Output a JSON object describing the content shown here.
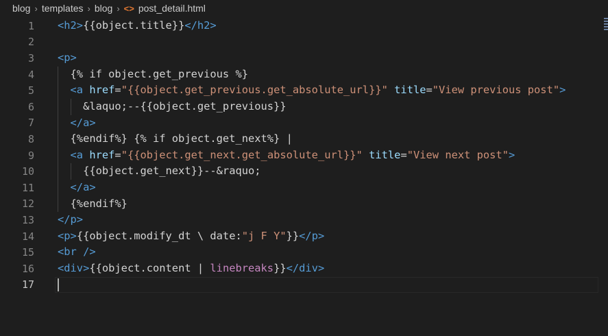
{
  "breadcrumb": {
    "items": [
      "blog",
      "templates",
      "blog"
    ],
    "file": "post_detail.html",
    "file_icon": "html-file-icon"
  },
  "editor": {
    "active_line": 17,
    "lines": [
      {
        "n": "1",
        "tokens": [
          [
            "tag",
            "<h2>"
          ],
          [
            "tpl",
            "{{object.title}}"
          ],
          [
            "tag",
            "</h2>"
          ]
        ]
      },
      {
        "n": "2",
        "tokens": []
      },
      {
        "n": "3",
        "tokens": [
          [
            "tag",
            "<p>"
          ]
        ]
      },
      {
        "n": "4",
        "tokens": [
          [
            "tpl",
            "  {% if object.get_previous %}"
          ]
        ]
      },
      {
        "n": "5",
        "tokens": [
          [
            "tag",
            "  <a "
          ],
          [
            "attr",
            "href"
          ],
          [
            "txt",
            "="
          ],
          [
            "str",
            "\"{{object.get_previous.get_absolute_url}}\""
          ],
          [
            "txt",
            " "
          ],
          [
            "attr",
            "title"
          ],
          [
            "txt",
            "="
          ],
          [
            "str",
            "\"View previous post\""
          ],
          [
            "tag",
            ">"
          ]
        ]
      },
      {
        "n": "6",
        "tokens": [
          [
            "txt",
            "    &laquo;--"
          ],
          [
            "tpl",
            "{{object.get_previous}}"
          ]
        ]
      },
      {
        "n": "7",
        "tokens": [
          [
            "tag",
            "  </a>"
          ]
        ]
      },
      {
        "n": "8",
        "tokens": [
          [
            "tpl",
            "  {%endif%} {% if object.get_next%} "
          ],
          [
            "txt",
            "|"
          ]
        ]
      },
      {
        "n": "9",
        "tokens": [
          [
            "tag",
            "  <a "
          ],
          [
            "attr",
            "href"
          ],
          [
            "txt",
            "="
          ],
          [
            "str",
            "\"{{object.get_next.get_absolute_url}}\""
          ],
          [
            "txt",
            " "
          ],
          [
            "attr",
            "title"
          ],
          [
            "txt",
            "="
          ],
          [
            "str",
            "\"View next post\""
          ],
          [
            "tag",
            ">"
          ]
        ]
      },
      {
        "n": "10",
        "tokens": [
          [
            "tpl",
            "    {{object.get_next}}"
          ],
          [
            "txt",
            "--&raquo;"
          ]
        ]
      },
      {
        "n": "11",
        "tokens": [
          [
            "tag",
            "  </a>"
          ]
        ]
      },
      {
        "n": "12",
        "tokens": [
          [
            "tpl",
            "  {%endif%}"
          ]
        ]
      },
      {
        "n": "13",
        "tokens": [
          [
            "tag",
            "</p>"
          ]
        ]
      },
      {
        "n": "14",
        "tokens": [
          [
            "tag",
            "<p>"
          ],
          [
            "tpl",
            "{{object.modify_dt \\ date:"
          ],
          [
            "str",
            "\"j F Y\""
          ],
          [
            "tpl",
            "}}"
          ],
          [
            "tag",
            "</p>"
          ]
        ]
      },
      {
        "n": "15",
        "tokens": [
          [
            "tag",
            "<br />"
          ]
        ]
      },
      {
        "n": "16",
        "tokens": [
          [
            "tag",
            "<div>"
          ],
          [
            "tpl",
            "{{object.content | "
          ],
          [
            "kw",
            "linebreaks"
          ],
          [
            "tpl",
            "}}"
          ],
          [
            "tag",
            "</div>"
          ]
        ]
      },
      {
        "n": "17",
        "tokens": []
      }
    ]
  },
  "colors": {
    "background": "#1e1e1e",
    "tag": "#569cd6",
    "attribute": "#9cdcfe",
    "string": "#ce9178",
    "filter": "#c586c0",
    "text": "#d4d4d4",
    "line_number": "#858585"
  }
}
